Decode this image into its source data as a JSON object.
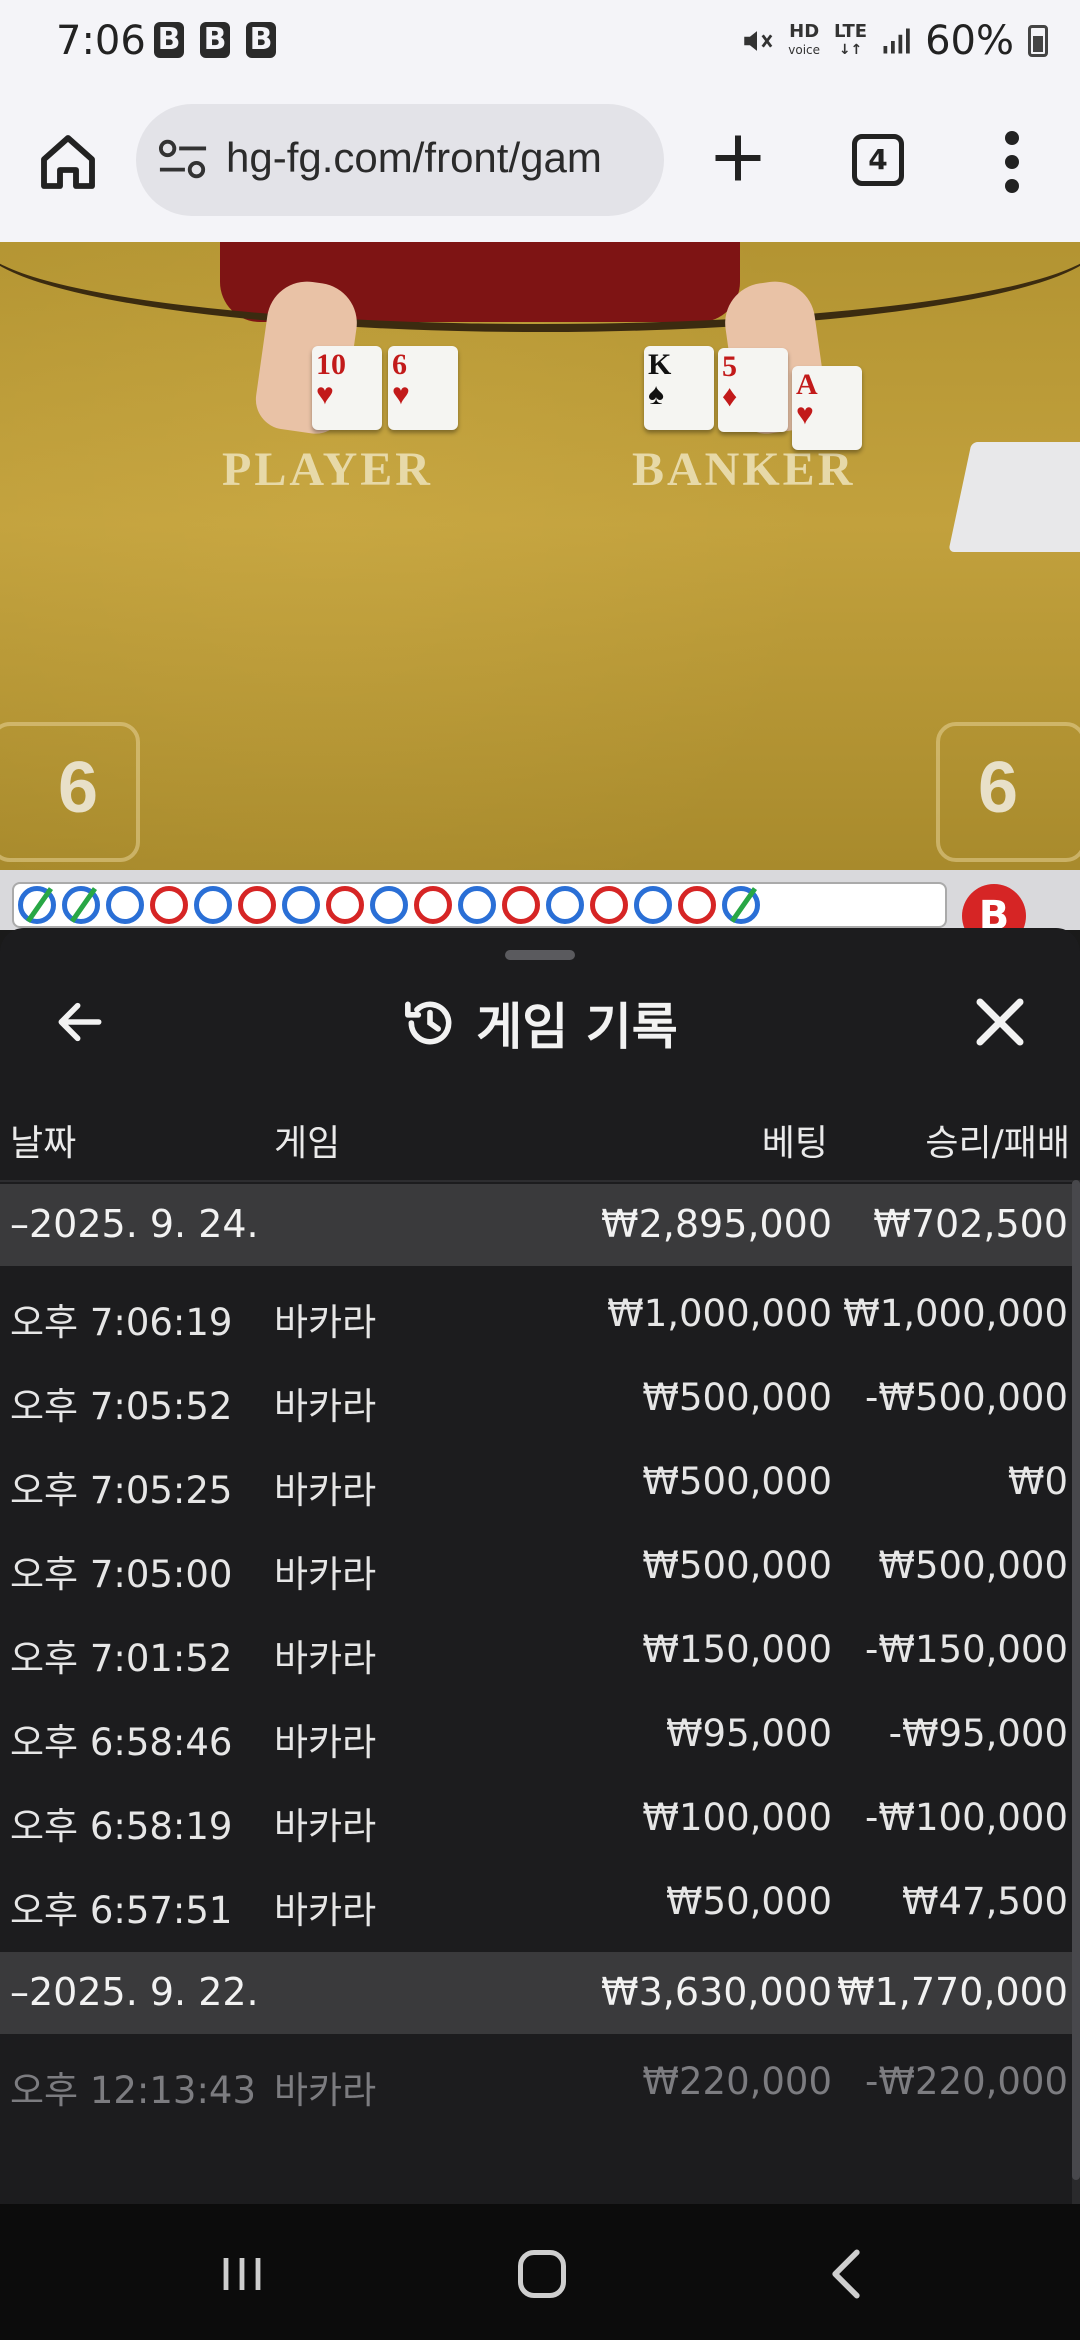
{
  "status_bar": {
    "time": "7:06",
    "indicators": [
      "B",
      "B",
      "B"
    ],
    "hd_label": "HD",
    "voice_label": "voice",
    "lte_label": "LTE",
    "battery": "60%",
    "icons": [
      "mute-icon",
      "signal-icon",
      "battery-icon"
    ]
  },
  "browser": {
    "url": "hg-fg.com/front/gam",
    "tab_count": "4",
    "icons": [
      "home-icon",
      "site-settings-icon",
      "plus-icon",
      "tabs-icon",
      "more-vert-icon"
    ]
  },
  "game": {
    "player_label": "PLAYER",
    "banker_label": "BANKER",
    "player_score": "6",
    "banker_score": "6",
    "player_cards": [
      {
        "rank": "10",
        "suit": "♥",
        "color": "red"
      },
      {
        "rank": "6",
        "suit": "♥",
        "color": "red"
      }
    ],
    "banker_cards": [
      {
        "rank": "K",
        "suit": "♠",
        "color": "black"
      },
      {
        "rank": "5",
        "suit": "♦",
        "color": "red"
      },
      {
        "rank": "A",
        "suit": "♥",
        "color": "red"
      }
    ],
    "road_badge": "B"
  },
  "sheet": {
    "title": "게임 기록",
    "headers": {
      "date": "날짜",
      "game": "게임",
      "bet": "베팅",
      "result": "승리/패배"
    },
    "groups": [
      {
        "date": "–2025. 9. 24.",
        "bet_total": "₩2,895,000",
        "result_total": "₩702,500",
        "rows": [
          {
            "time": "오후 7:06:19",
            "game": "바카라",
            "bet": "₩1,000,000",
            "result": "₩1,000,000"
          },
          {
            "time": "오후 7:05:52",
            "game": "바카라",
            "bet": "₩500,000",
            "result": "-₩500,000"
          },
          {
            "time": "오후 7:05:25",
            "game": "바카라",
            "bet": "₩500,000",
            "result": "₩0"
          },
          {
            "time": "오후 7:05:00",
            "game": "바카라",
            "bet": "₩500,000",
            "result": "₩500,000"
          },
          {
            "time": "오후 7:01:52",
            "game": "바카라",
            "bet": "₩150,000",
            "result": "-₩150,000"
          },
          {
            "time": "오후 6:58:46",
            "game": "바카라",
            "bet": "₩95,000",
            "result": "-₩95,000"
          },
          {
            "time": "오후 6:58:19",
            "game": "바카라",
            "bet": "₩100,000",
            "result": "-₩100,000"
          },
          {
            "time": "오후 6:57:51",
            "game": "바카라",
            "bet": "₩50,000",
            "result": "₩47,500"
          }
        ]
      },
      {
        "date": "–2025. 9. 22.",
        "bet_total": "₩3,630,000",
        "result_total": "₩1,770,000",
        "rows": [
          {
            "time": "오후 12:13:43",
            "game": "바카라",
            "bet": "₩220,000",
            "result": "-₩220,000"
          }
        ]
      }
    ]
  },
  "colors": {
    "sheet_bg": "#1c1c1e",
    "date_row_bg": "#3a3a3c",
    "felt": "#b99a33",
    "road_red": "#d62525",
    "road_blue": "#2a6fd6"
  }
}
